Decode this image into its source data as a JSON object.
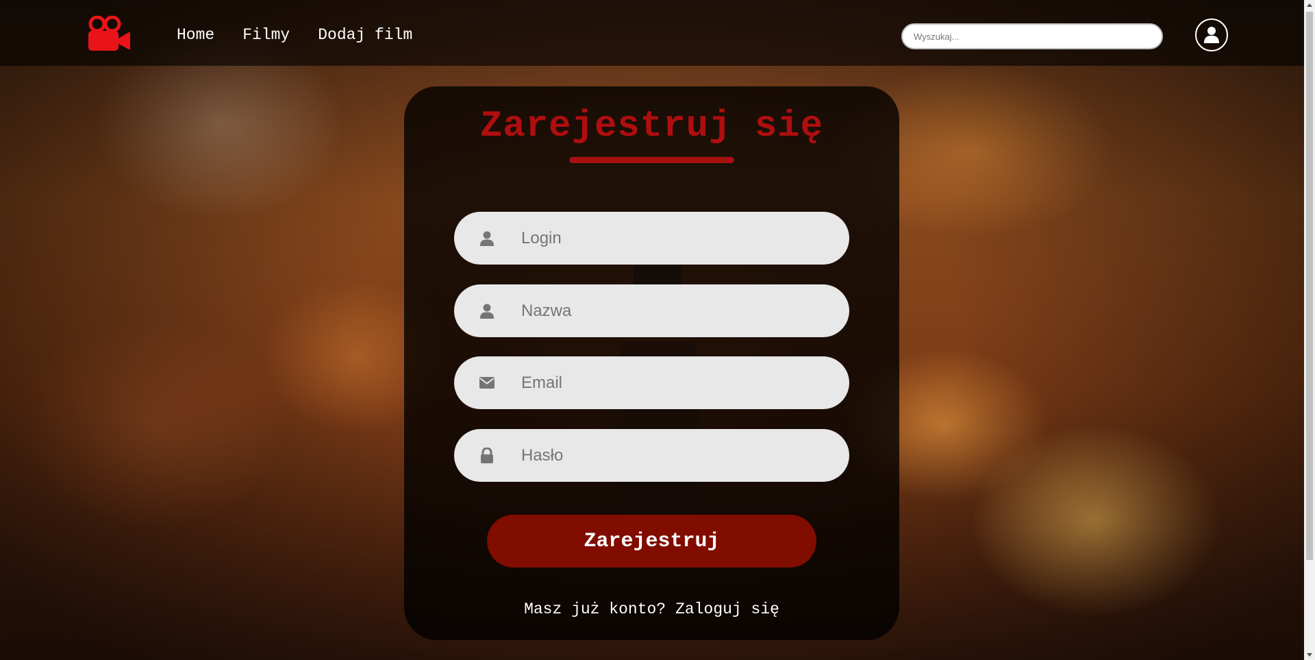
{
  "nav": {
    "links": [
      "Home",
      "Filmy",
      "Dodaj film"
    ],
    "search_placeholder": "Wyszukaj..."
  },
  "register": {
    "title": "Zarejestruj się",
    "fields": [
      {
        "placeholder": "Login",
        "icon": "user-icon"
      },
      {
        "placeholder": "Nazwa",
        "icon": "user-icon"
      },
      {
        "placeholder": "Email",
        "icon": "envelope-icon"
      },
      {
        "placeholder": "Hasło",
        "icon": "lock-icon"
      }
    ],
    "submit_label": "Zarejestruj",
    "have_account_text": "Masz już konto?",
    "login_link": "Zaloguj się"
  },
  "colors": {
    "accent_red": "#b00e0e",
    "button_red": "#810c00",
    "field_bg": "#e8e8e8"
  }
}
